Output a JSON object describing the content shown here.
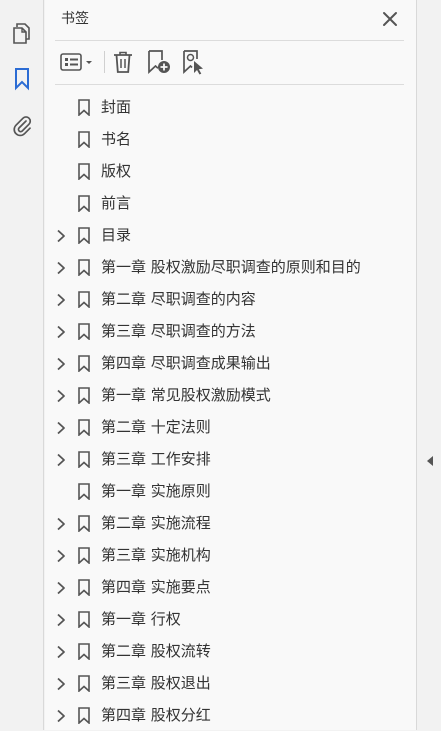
{
  "panel": {
    "title": "书签"
  },
  "left_rail": {
    "items": [
      "pages-icon",
      "bookmark-icon",
      "attachment-icon"
    ]
  },
  "toolbar": {
    "items": [
      "options-menu-icon",
      "delete-icon",
      "new-bookmark-icon",
      "bookmark-from-selection-icon"
    ]
  },
  "colors": {
    "accent": "#2b6cd4",
    "icon": "#555555",
    "text": "#333333"
  },
  "bookmarks": [
    {
      "label": "封面",
      "expandable": false
    },
    {
      "label": "书名",
      "expandable": false
    },
    {
      "label": "版权",
      "expandable": false
    },
    {
      "label": "前言",
      "expandable": false
    },
    {
      "label": "目录",
      "expandable": true
    },
    {
      "label": "第一章  股权激励尽职调查的原则和目的",
      "expandable": true
    },
    {
      "label": "第二章  尽职调查的内容",
      "expandable": true
    },
    {
      "label": "第三章  尽职调查的方法",
      "expandable": true
    },
    {
      "label": "第四章  尽职调查成果输出",
      "expandable": true
    },
    {
      "label": "第一章  常见股权激励模式",
      "expandable": true
    },
    {
      "label": "第二章  十定法则",
      "expandable": true
    },
    {
      "label": "第三章  工作安排",
      "expandable": true
    },
    {
      "label": "第一章  实施原则",
      "expandable": false
    },
    {
      "label": "第二章  实施流程",
      "expandable": true
    },
    {
      "label": "第三章  实施机构",
      "expandable": true
    },
    {
      "label": "第四章  实施要点",
      "expandable": true
    },
    {
      "label": "第一章  行权",
      "expandable": true
    },
    {
      "label": "第二章  股权流转",
      "expandable": true
    },
    {
      "label": "第三章  股权退出",
      "expandable": true
    },
    {
      "label": "第四章  股权分红",
      "expandable": true
    }
  ]
}
